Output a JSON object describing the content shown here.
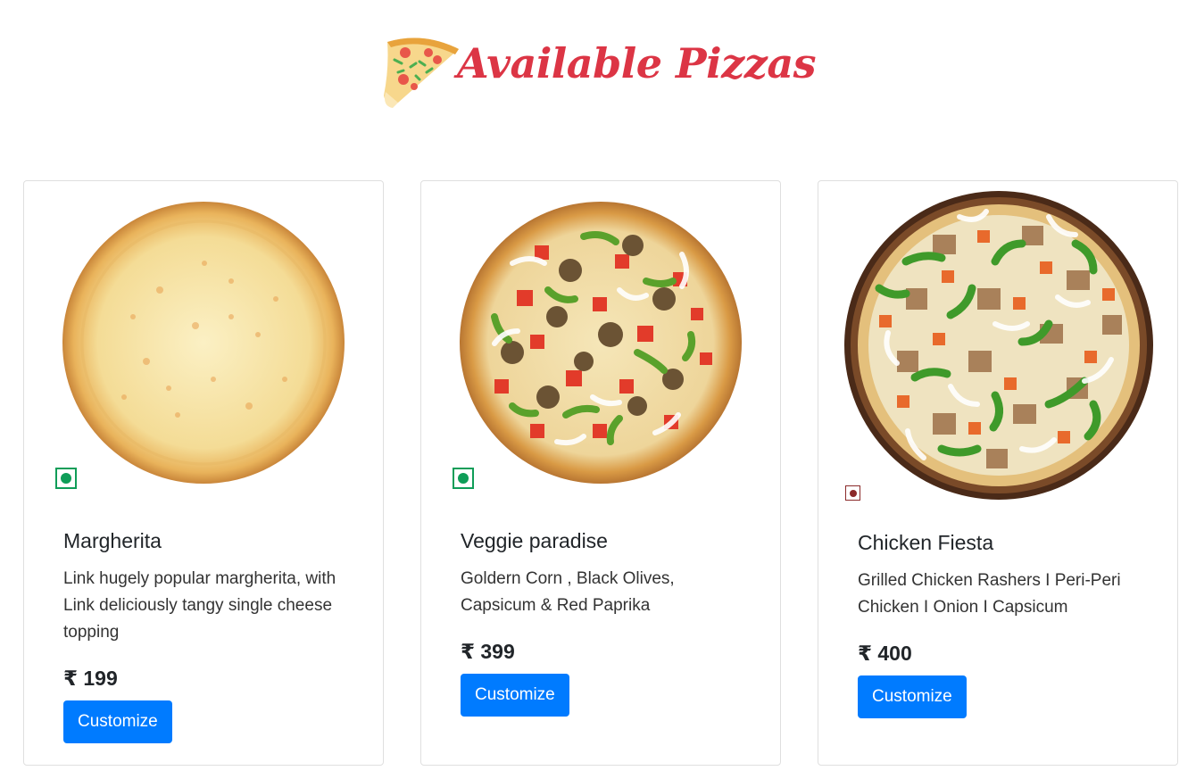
{
  "header": {
    "title": "Available Pizzas",
    "logo_icon": "pizza-slice-icon"
  },
  "pizzas": [
    {
      "name": "Margherita",
      "description": "Link hugely popular margherita, with Link deliciously tangy single cheese topping",
      "price": "₹ 199",
      "button_label": "Customize",
      "diet": "veg",
      "image": "margherita-pizza-image"
    },
    {
      "name": "Veggie paradise",
      "description": "Goldern Corn , Black Olives, Capsicum & Red Paprika",
      "price": "₹ 399",
      "button_label": "Customize",
      "diet": "veg",
      "image": "veggie-paradise-pizza-image"
    },
    {
      "name": "Chicken Fiesta",
      "description": "Grilled Chicken Rashers I Peri-Peri Chicken I Onion I Capsicum",
      "price": "₹ 400",
      "button_label": "Customize",
      "diet": "non-veg",
      "image": "chicken-fiesta-pizza-image"
    }
  ],
  "colors": {
    "title": "#dc3545",
    "button": "#007bff",
    "veg": "#0f9d58",
    "non_veg": "#8b2a2a"
  }
}
